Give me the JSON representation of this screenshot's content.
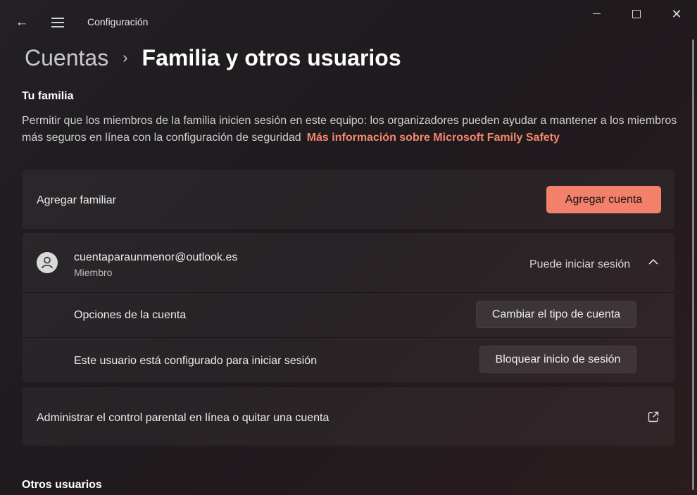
{
  "titlebar": {
    "title": "Configuración",
    "back_icon": "arrow-left-icon",
    "menu_icon": "hamburger-icon",
    "minimize_icon": "minimize-icon",
    "maximize_icon": "maximize-icon",
    "close_icon": "close-icon"
  },
  "breadcrumb": {
    "parent": "Cuentas",
    "separator": "›",
    "current": "Familia y otros usuarios"
  },
  "family": {
    "heading": "Tu familia",
    "description": "Permitir que los miembros de la familia inicien sesión en este equipo: los organizadores pueden ayudar a mantener a los miembros más seguros en línea con la configuración de seguridad",
    "link": "Más información sobre Microsoft Family Safety",
    "add_member": {
      "label": "Agregar familiar",
      "button": "Agregar cuenta"
    },
    "member": {
      "email": "cuentaparaunmenor@outlook.es",
      "role": "Miembro",
      "status": "Puede iniciar sesión",
      "expand_icon": "chevron-up-icon",
      "options": {
        "account_options_label": "Opciones de la cuenta",
        "change_type_button": "Cambiar el tipo de cuenta",
        "signin_label": "Este usuario está configurado para iniciar sesión",
        "block_button": "Bloquear inicio de sesión"
      }
    },
    "manage": {
      "label": "Administrar el control parental en línea o quitar una cuenta",
      "icon": "open-external-icon"
    }
  },
  "other_users": {
    "heading": "Otros usuarios"
  },
  "colors": {
    "accent": "#f2806a",
    "link": "#f3886e",
    "background": "#1f1b1e"
  }
}
